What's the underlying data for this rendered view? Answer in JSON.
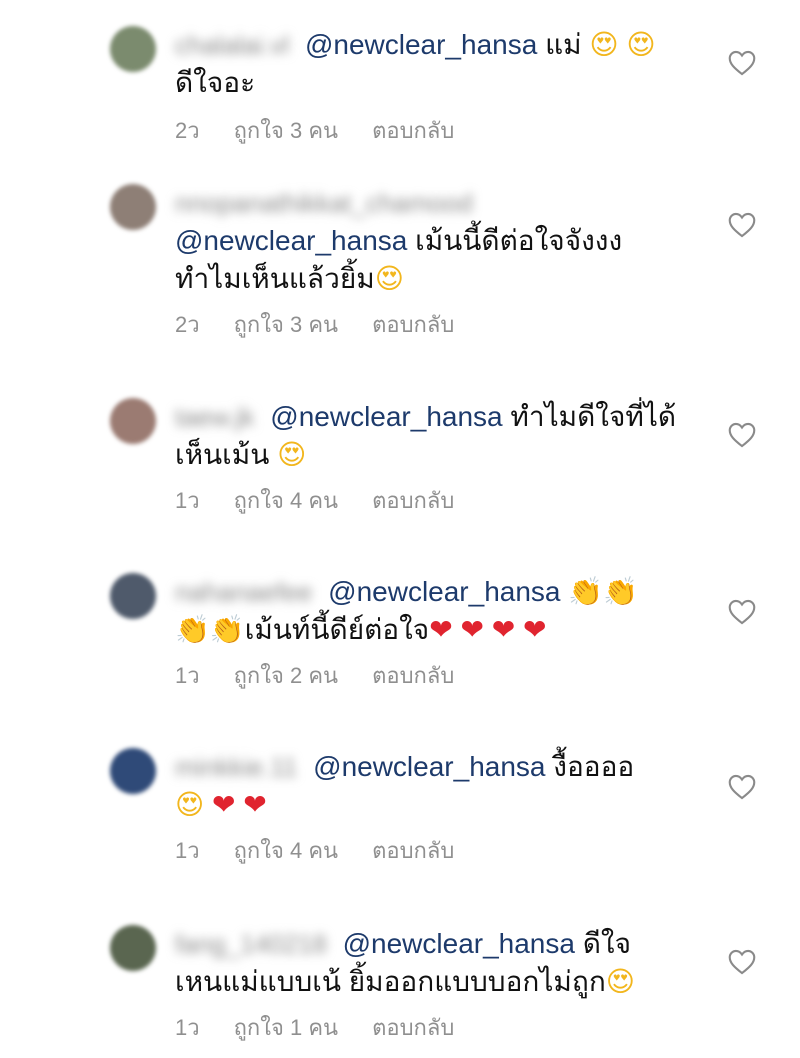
{
  "comments": [
    {
      "username": "chalalai.vl",
      "mention": "@newclear_hansa",
      "text": "แม่",
      "emojis": [
        "heart-eyes",
        "heart-eyes"
      ],
      "text2": "ดีใจอะ",
      "age": "2ว",
      "likes": "ถูกใจ 3 คน",
      "reply": "ตอบกลับ",
      "avatar_color": "#7b8b6e"
    },
    {
      "username": "nnopanathikkat_chamood",
      "mention": "@newclear_hansa",
      "text": "เม้นนี้ดีต่อใจจังงง",
      "text2": "ทำไมเห็นแล้วยิ้ม",
      "emojis": [
        "heart-eyes"
      ],
      "age": "2ว",
      "likes": "ถูกใจ 3 คน",
      "reply": "ตอบกลับ",
      "avatar_color": "#8e7f76"
    },
    {
      "username": "taew.jk",
      "mention": "@newclear_hansa",
      "text": "ทำไมดีใจที่ได้",
      "text2": "เห็นเม้น",
      "emojis": [
        "heart-eyes"
      ],
      "age": "1ว",
      "likes": "ถูกใจ 4 คน",
      "reply": "ตอบกลับ",
      "avatar_color": "#9b7b72"
    },
    {
      "username": "nahanaefee",
      "mention": "@newclear_hansa",
      "text": "เม้นท์นี้ดีย์ต่อใจ",
      "emojis_before": [
        "clap",
        "clap"
      ],
      "emojis_mid": [
        "clap",
        "clap"
      ],
      "emojis_after": [
        "heart",
        "heart",
        "heart",
        "heart"
      ],
      "age": "1ว",
      "likes": "ถูกใจ 2 คน",
      "reply": "ตอบกลับ",
      "avatar_color": "#4f5a6b"
    },
    {
      "username": "minkkie.11",
      "mention": "@newclear_hansa",
      "text": "งื้ออออ",
      "emojis": [
        "heart-eyes",
        "heart",
        "heart"
      ],
      "age": "1ว",
      "likes": "ถูกใจ 4 คน",
      "reply": "ตอบกลับ",
      "avatar_color": "#2f4a78"
    },
    {
      "username": "fang_140218",
      "mention": "@newclear_hansa",
      "text": "ดีใจ",
      "text2": "เหนแม่แบบเน้ ยิ้มออกแบบบอกไม่ถูก",
      "emojis": [
        "heart-eyes"
      ],
      "age": "1ว",
      "likes": "ถูกใจ 1 คน",
      "reply": "ตอบกลับ",
      "avatar_color": "#5a6650"
    }
  ],
  "icons": {
    "like": "heart-outline-icon",
    "heart_emoji": "❤",
    "heart_eyes_emoji": "😍",
    "clap_emoji": "👏"
  },
  "colors": {
    "mention": "#1d3a6b",
    "meta": "#8f8f8f",
    "heart": "#e0242f"
  }
}
